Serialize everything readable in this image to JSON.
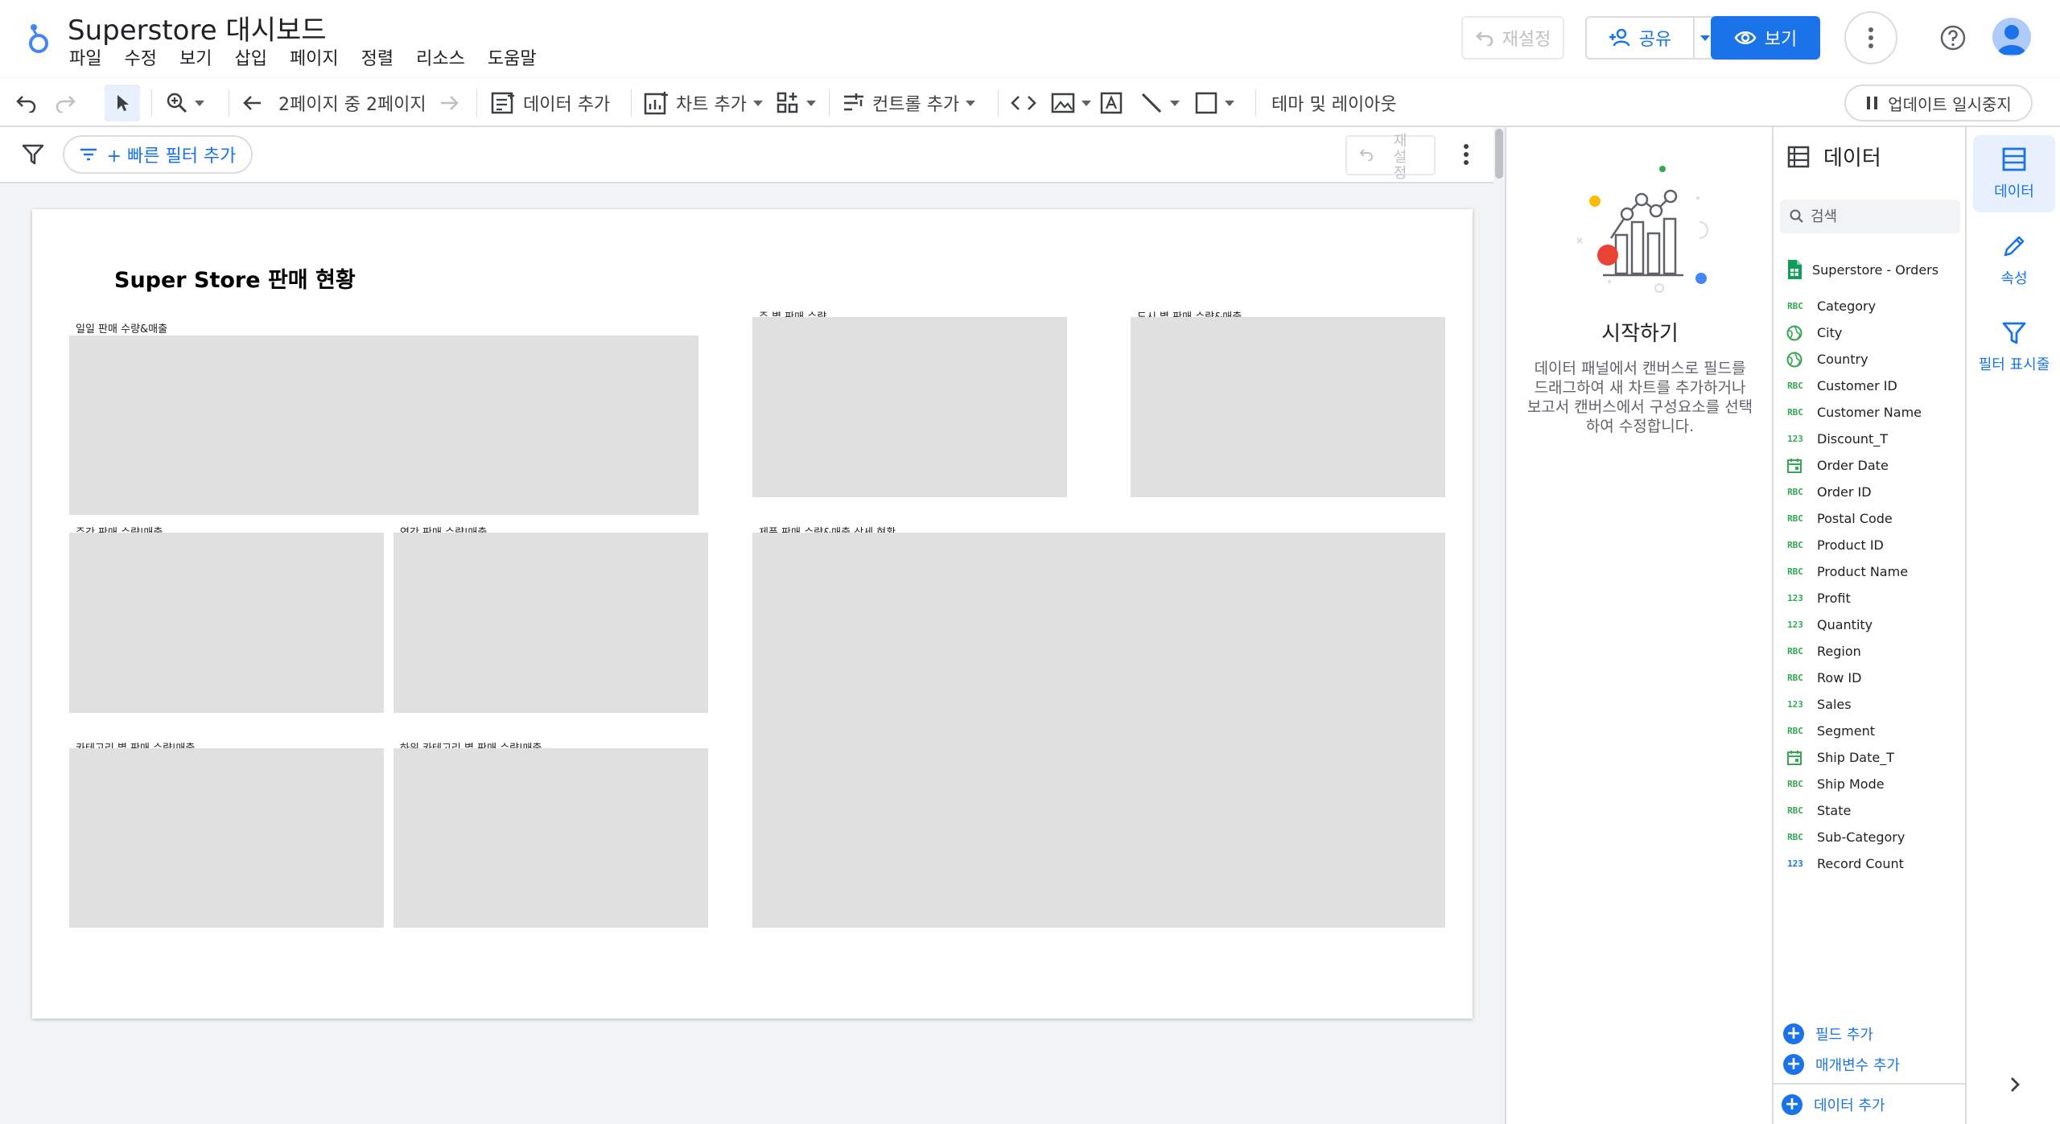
{
  "app": {
    "title": "Superstore 대시보드",
    "menu": [
      "파일",
      "수정",
      "보기",
      "삽입",
      "페이지",
      "정렬",
      "리소스",
      "도움말"
    ],
    "reset_label": "재설정",
    "share_label": "공유",
    "view_label": "보기"
  },
  "toolbar": {
    "page_indicator": "2페이지 중 2페이지",
    "add_data_label": "데이터 추가",
    "add_chart_label": "차트 추가",
    "add_control_label": "컨트롤 추가",
    "theme_layout_label": "테마 및 레이아웃",
    "pause_updates_label": "업데이트 일시중지"
  },
  "filter_bar": {
    "quick_filter_label": "+ 빠른 필터 추가",
    "reset_label": "재설정"
  },
  "report": {
    "title": "Super Store 판매 현황",
    "charts": [
      {
        "title": "일일 판매 수량&매출"
      },
      {
        "title": "주 별 판매 수량"
      },
      {
        "title": "도시 별 판매 수량&매출"
      },
      {
        "title": "주간 판매 수량|매출"
      },
      {
        "title": "연간 판매 수량|매출"
      },
      {
        "title": "제품 판매 수량&매출 상세 현황"
      },
      {
        "title": "카테고리 별 판매 수량|매출"
      },
      {
        "title": "하위 카테고리 별 판매 수량|매출"
      }
    ]
  },
  "getting_started": {
    "title": "시작하기",
    "description": "데이터 패널에서 캔버스로 필드를 드래그하여 새 차트를 추가하거나 보고서 캔버스에서 구성요소를 선택하여 수정합니다."
  },
  "data_panel": {
    "title": "데이터",
    "search_placeholder": "검색",
    "source_name": "Superstore - Orders",
    "fields": [
      {
        "name": "Category",
        "type": "RBC"
      },
      {
        "name": "City",
        "type": "geo"
      },
      {
        "name": "Country",
        "type": "geo"
      },
      {
        "name": "Customer ID",
        "type": "RBC"
      },
      {
        "name": "Customer Name",
        "type": "RBC"
      },
      {
        "name": "Discount_T",
        "type": "123"
      },
      {
        "name": "Order Date",
        "type": "date"
      },
      {
        "name": "Order ID",
        "type": "RBC"
      },
      {
        "name": "Postal Code",
        "type": "RBC"
      },
      {
        "name": "Product ID",
        "type": "RBC"
      },
      {
        "name": "Product Name",
        "type": "RBC"
      },
      {
        "name": "Profit",
        "type": "123"
      },
      {
        "name": "Quantity",
        "type": "123"
      },
      {
        "name": "Region",
        "type": "RBC"
      },
      {
        "name": "Row ID",
        "type": "RBC"
      },
      {
        "name": "Sales",
        "type": "123"
      },
      {
        "name": "Segment",
        "type": "RBC"
      },
      {
        "name": "Ship Date_T",
        "type": "date"
      },
      {
        "name": "Ship Mode",
        "type": "RBC"
      },
      {
        "name": "State",
        "type": "RBC"
      },
      {
        "name": "Sub-Category",
        "type": "RBC"
      },
      {
        "name": "Record Count",
        "type": "123"
      }
    ],
    "add_field_label": "필드 추가",
    "add_parameter_label": "매개변수 추가",
    "add_data_label": "데이터 추가"
  },
  "right_rail": {
    "data_tab": "데이터",
    "properties_tab": "속성",
    "filter_tab": "필터 표시줄"
  },
  "colors": {
    "accent": "#1a73e8",
    "chart_placeholder": "#e0e0e0",
    "canvas_bg": "#f1f3f4"
  }
}
